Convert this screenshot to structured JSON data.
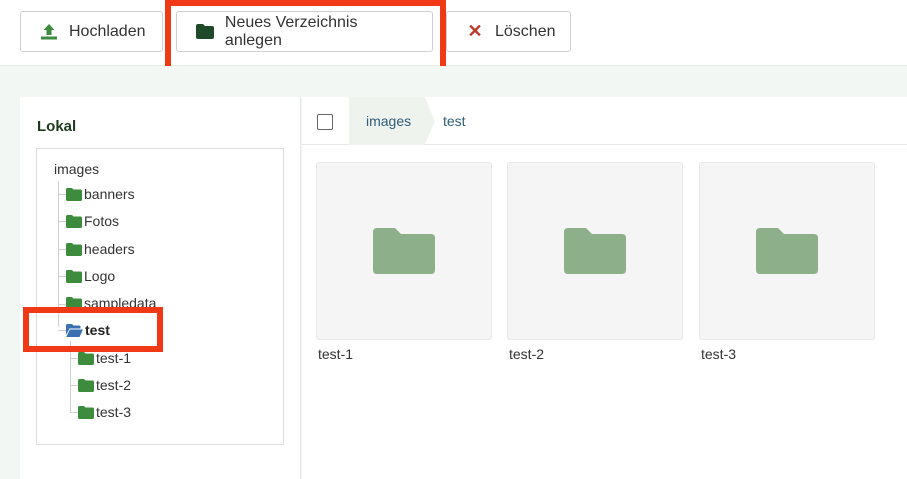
{
  "toolbar": {
    "upload_label": "Hochladen",
    "new_folder_label": "Neues Verzeichnis anlegen",
    "delete_label": "Löschen"
  },
  "sidebar": {
    "title": "Lokal",
    "root": "images",
    "items": [
      {
        "label": "banners"
      },
      {
        "label": "Fotos"
      },
      {
        "label": "headers"
      },
      {
        "label": "Logo"
      },
      {
        "label": "sampledata"
      },
      {
        "label": "test"
      },
      {
        "label": "test-1"
      },
      {
        "label": "test-2"
      },
      {
        "label": "test-3"
      }
    ]
  },
  "breadcrumb": [
    "images",
    "test"
  ],
  "folders": [
    {
      "label": "test-1"
    },
    {
      "label": "test-2"
    },
    {
      "label": "test-3"
    }
  ],
  "colors": {
    "accent": "#3d8b3d",
    "highlight": "#f03a17",
    "folder_tile": "#8db08a",
    "open_folder": "#3a6fb0"
  },
  "icons": {
    "upload": "upload-icon",
    "new_folder": "folder-icon",
    "delete": "close-icon"
  }
}
